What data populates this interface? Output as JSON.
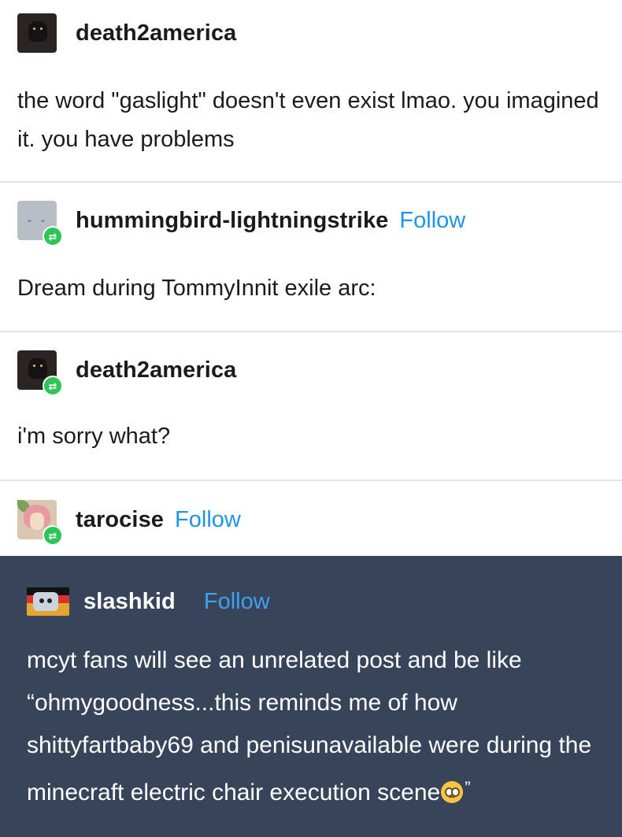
{
  "posts": [
    {
      "username": "death2america",
      "follow": "",
      "text": "the word \"gaslight\" doesn't even exist lmao. you imagined it. you have problems",
      "avatar_icon": "dark-cat-avatar",
      "reblog": false
    },
    {
      "username": "hummingbird-lightningstrike",
      "follow": "Follow",
      "text": "Dream during TommyInnit exile arc:",
      "avatar_icon": "gray-avatar",
      "reblog": true
    },
    {
      "username": "death2america",
      "follow": "",
      "text": "i'm sorry what?",
      "avatar_icon": "dark-cat-avatar",
      "reblog": true
    },
    {
      "username": "tarocise",
      "follow": "Follow",
      "text": "",
      "avatar_icon": "pink-hair-avatar",
      "reblog": true
    }
  ],
  "quoted_post": {
    "username": "slashkid",
    "follow": "Follow",
    "text": "mcyt fans will see an unrelated post and be like “ohmygoodness...this reminds me of how shittyfartbaby69 and penisunavailable  were during the minecraft electric chair execution scene",
    "emoji_icon": "pleading-face-emoji",
    "closing_quote": "”",
    "background": "#384459"
  },
  "colors": {
    "follow_link": "#1e93ea",
    "reblog_badge": "#2ec458",
    "divider": "#e4e4e4"
  }
}
